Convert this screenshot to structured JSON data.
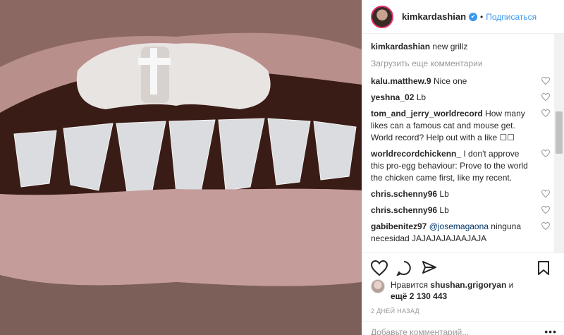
{
  "post": {
    "username": "kimkardashian",
    "verified_mark": "✔",
    "separator": "•",
    "follow_label": "Подписаться",
    "caption_user": "kimkardashian",
    "caption_text": "new grillz",
    "load_more_label": "Загрузить еще комментарии"
  },
  "comments": [
    {
      "user": "kalu.matthew.9",
      "text": "Nice one"
    },
    {
      "user": "yeshna_02",
      "text": "Lb"
    },
    {
      "user": "tom_and_jerry_worldrecord",
      "text": "How many likes can a famous cat and mouse get. World record? Help out with a like ☐☐"
    },
    {
      "user": "worldrecordchickenn_",
      "text": "I don't approve this pro-egg behaviour: Prove to the world the chicken came first, like my recent."
    },
    {
      "user": "chris.schenny96",
      "text": "Lb"
    },
    {
      "user": "chris.schenny96",
      "text": "Lb"
    },
    {
      "user": "gabibenitez97",
      "mention": "@josemagaona",
      "text": "ninguna necesidad JAJAJAJAJAAJAJA"
    }
  ],
  "likes": {
    "prefix": "Нравится",
    "user": "shushan.grigoryan",
    "and": "и",
    "more": "ещё 2 130 443"
  },
  "timestamp": "2 ДНЕЙ НАЗАД",
  "add_comment_placeholder": "Добавьте комментарий...",
  "icons": [
    "heart-icon",
    "comment-icon",
    "share-icon",
    "bookmark-icon",
    "more-icon"
  ],
  "colors": {
    "link": "#3897f0",
    "verified": "#3897f0",
    "muted": "#999999"
  }
}
